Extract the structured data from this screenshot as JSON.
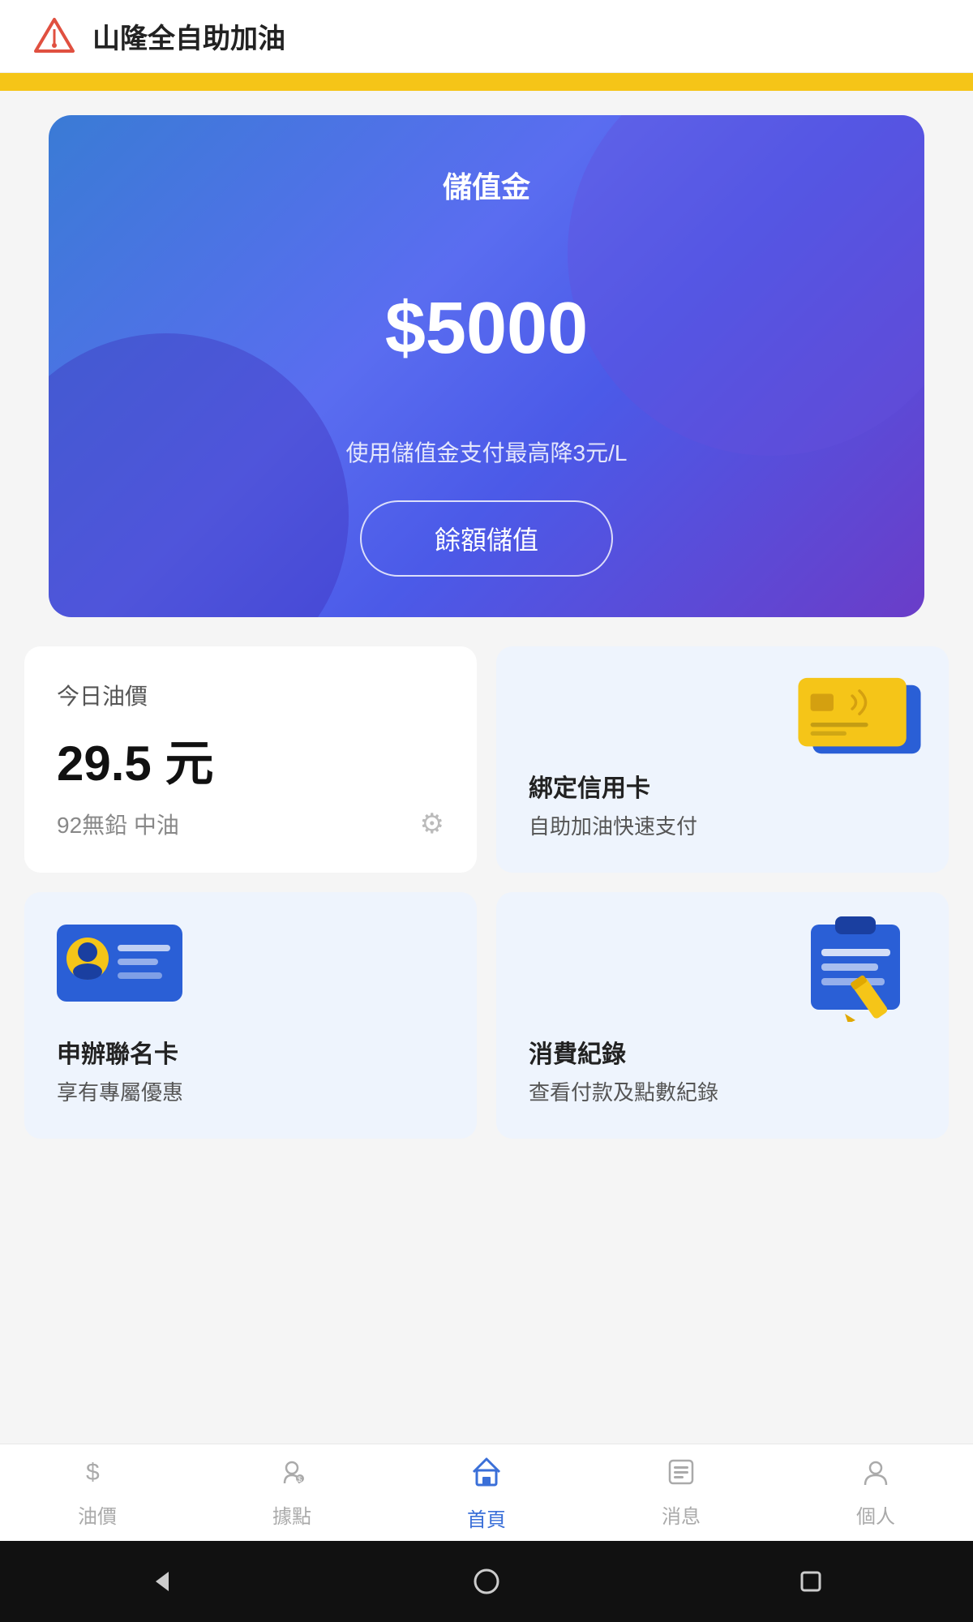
{
  "header": {
    "title": "山隆全自助加油",
    "logo_alt": "mountain-logo"
  },
  "blue_card": {
    "title": "儲值金",
    "amount": "$5000",
    "subtitle": "使用儲值金支付最高降3元/L",
    "btn_label": "餘額儲值"
  },
  "oil_card": {
    "label": "今日油價",
    "price": "29.5 元",
    "type": "92無鉛 中油"
  },
  "credit_card_feature": {
    "label": "綁定信用卡",
    "sublabel": "自助加油快速支付"
  },
  "member_card_feature": {
    "label": "申辦聯名卡",
    "sublabel": "享有專屬優惠"
  },
  "receipt_feature": {
    "label": "消費紀錄",
    "sublabel": "查看付款及點數紀錄"
  },
  "bottom_nav": {
    "items": [
      {
        "id": "oil-price",
        "label": "油價",
        "icon": "$"
      },
      {
        "id": "points",
        "label": "據點",
        "icon": "📍"
      },
      {
        "id": "home",
        "label": "首頁",
        "icon": "🏠"
      },
      {
        "id": "news",
        "label": "消息",
        "icon": "📋"
      },
      {
        "id": "profile",
        "label": "個人",
        "icon": "👤"
      }
    ]
  }
}
